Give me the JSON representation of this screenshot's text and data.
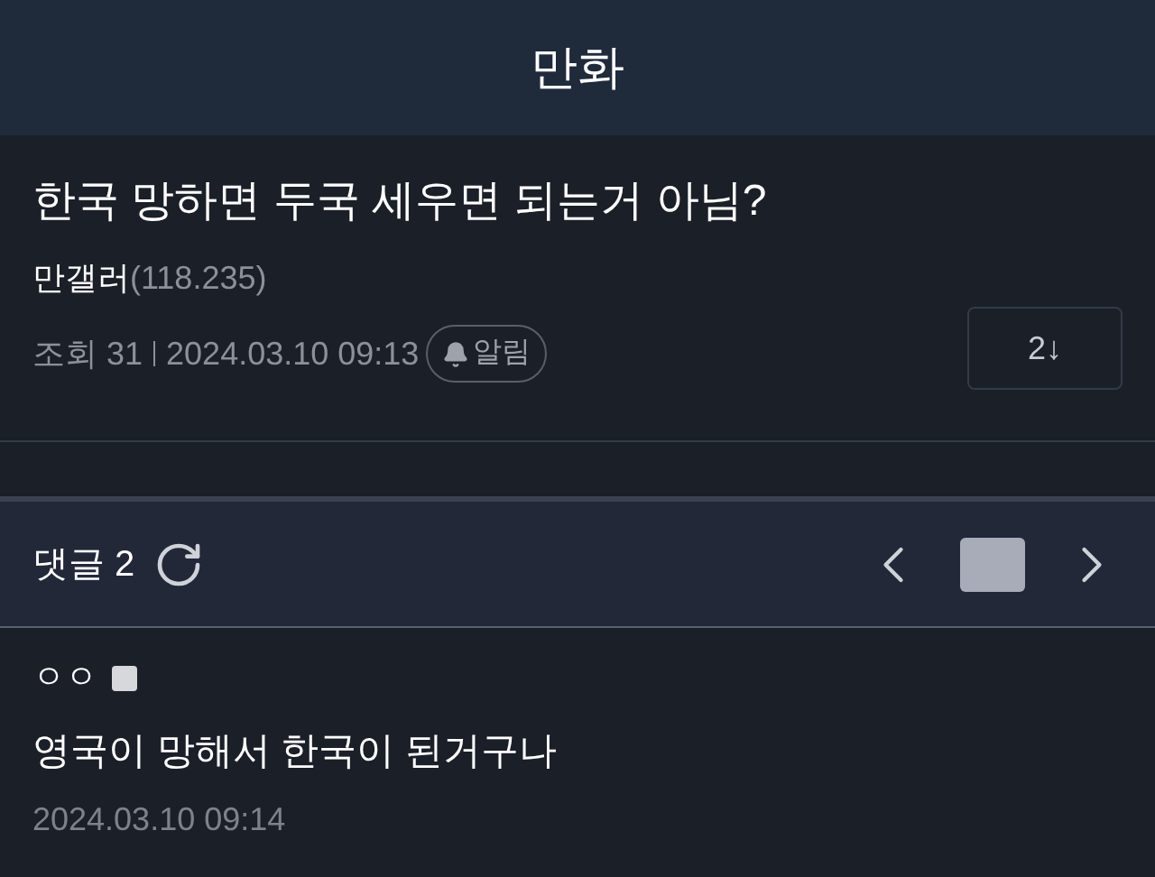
{
  "header": {
    "title": "만화"
  },
  "post": {
    "title": "한국 망하면 두국 세우면 되는거 아님?",
    "author": "만갤러",
    "author_ip": "(118.235)",
    "views": "조회 31",
    "date": "2024.03.10 09:13",
    "alert_button": "알림",
    "comment_jump": "2↓"
  },
  "comments_bar": {
    "label": "댓글 2"
  },
  "comments": [
    {
      "author": "ㅇㅇ",
      "text": "영국이 망해서 한국이 된거구나",
      "date": "2024.03.10 09:14"
    }
  ]
}
